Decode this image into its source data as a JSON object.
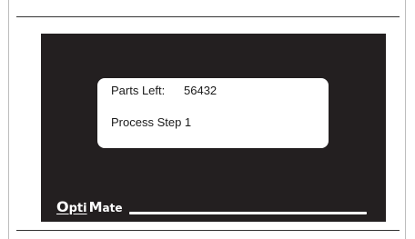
{
  "display": {
    "parts_left_label": "Parts Left:",
    "parts_left_value": "56432",
    "process_step": "Process Step 1"
  },
  "logo": {
    "opti_initial": "O",
    "opti_rest": "pti",
    "mate_initial": "M",
    "mate_rest": "ate"
  },
  "colors": {
    "screen_background": "#231f20",
    "panel_background": "#ffffff",
    "text": "#1a1a1a",
    "logo": "#ffffff"
  }
}
